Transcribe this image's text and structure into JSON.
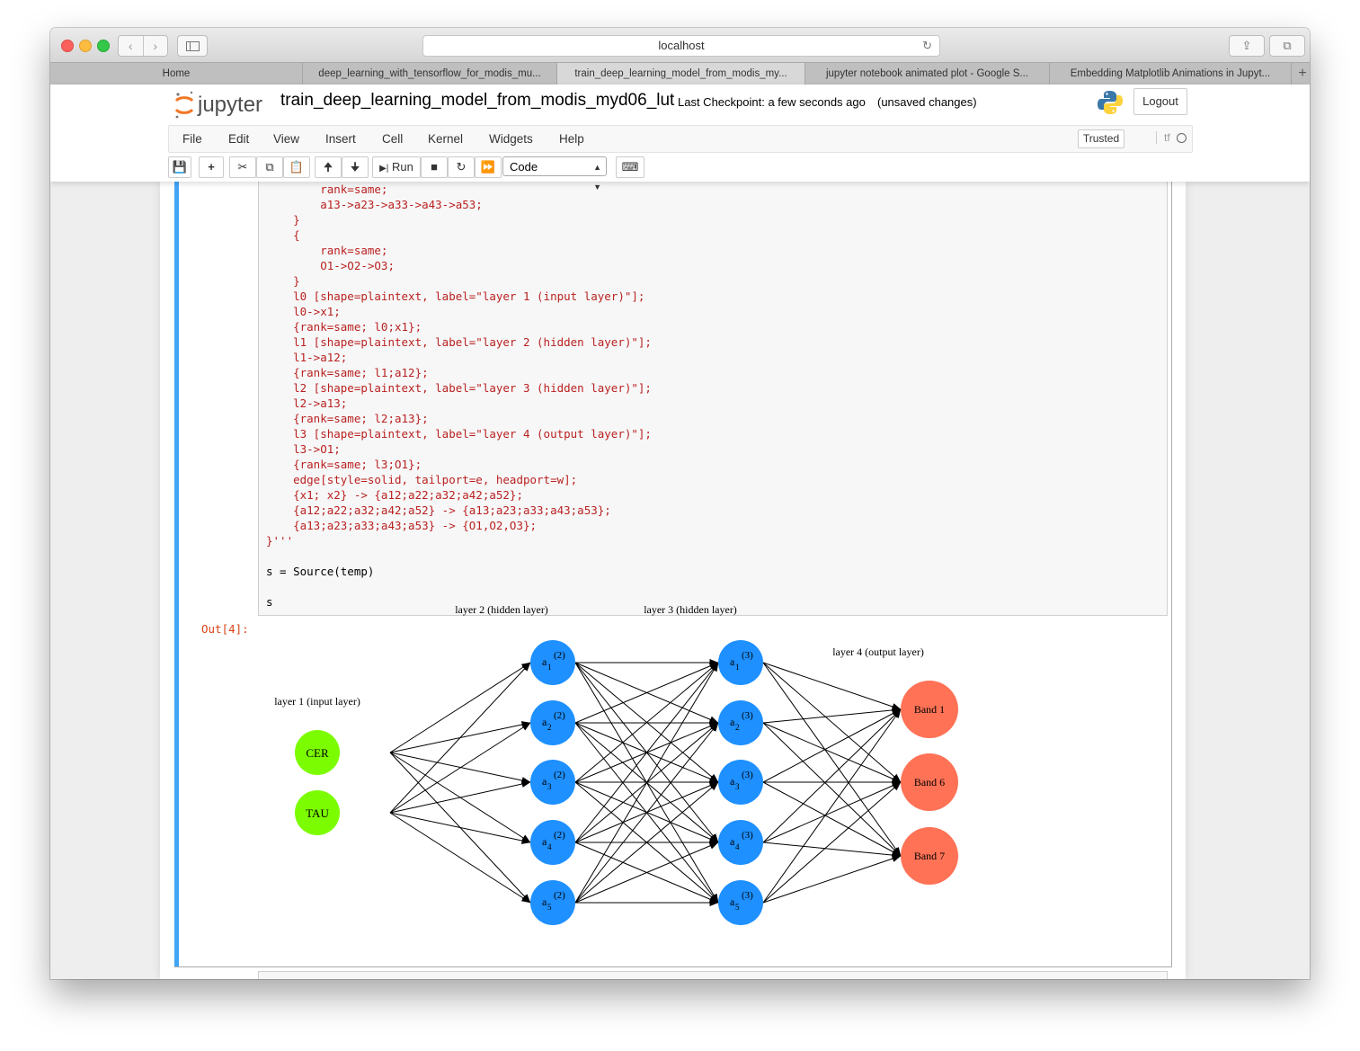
{
  "browser": {
    "url": "localhost",
    "tabs": [
      {
        "label": "Home",
        "active": false
      },
      {
        "label": "deep_learning_with_tensorflow_for_modis_mu...",
        "active": false
      },
      {
        "label": "train_deep_learning_model_from_modis_my...",
        "active": true
      },
      {
        "label": "jupyter notebook animated plot - Google S...",
        "active": false
      },
      {
        "label": "Embedding Matplotlib Animations in Jupyt...",
        "active": false
      }
    ],
    "new_tab_label": "+"
  },
  "header": {
    "logo_text": "jupyter",
    "notebook_name": "train_deep_learning_model_from_modis_myd06_lut",
    "checkpoint": "Last Checkpoint: a few seconds ago",
    "unsaved": "(unsaved changes)",
    "logout": "Logout"
  },
  "menu": {
    "items": [
      "File",
      "Edit",
      "View",
      "Insert",
      "Cell",
      "Kernel",
      "Widgets",
      "Help"
    ],
    "trusted": "Trusted",
    "kernel": "tf"
  },
  "toolbar": {
    "run_label": "Run",
    "cell_type": "Code"
  },
  "cell": {
    "code_lines": [
      "        rank=same;",
      "        a13->a23->a33->a43->a53;",
      "    }",
      "    {",
      "        rank=same;",
      "        O1->O2->O3;",
      "    }",
      "    l0 [shape=plaintext, label=\"layer 1 (input layer)\"];",
      "    l0->x1;",
      "    {rank=same; l0;x1};",
      "    l1 [shape=plaintext, label=\"layer 2 (hidden layer)\"];",
      "    l1->a12;",
      "    {rank=same; l1;a12};",
      "    l2 [shape=plaintext, label=\"layer 3 (hidden layer)\"];",
      "    l2->a13;",
      "    {rank=same; l2;a13};",
      "    l3 [shape=plaintext, label=\"layer 4 (output layer)\"];",
      "    l3->O1;",
      "    {rank=same; l3;O1};",
      "    edge[style=solid, tailport=e, headport=w];",
      "    {x1; x2} -> {a12;a22;a32;a42;a52};",
      "    {a12;a22;a32;a42;a52} -> {a13;a23;a33;a43;a53};",
      "    {a13;a23;a33;a43;a53} -> {O1,O2,O3};",
      "}'''",
      "",
      "s = Source(temp)",
      "",
      "s"
    ],
    "out_prompt": "Out[4]:"
  },
  "graph": {
    "layer_labels": [
      "layer 1 (input layer)",
      "layer 2 (hidden layer)",
      "layer 3 (hidden layer)",
      "layer 4 (output layer)"
    ],
    "input_nodes": [
      "CER",
      "TAU"
    ],
    "hidden1_nodes": [
      {
        "base": "a",
        "sub": "1",
        "sup": "(2)"
      },
      {
        "base": "a",
        "sub": "2",
        "sup": "(2)"
      },
      {
        "base": "a",
        "sub": "3",
        "sup": "(2)"
      },
      {
        "base": "a",
        "sub": "4",
        "sup": "(2)"
      },
      {
        "base": "a",
        "sub": "5",
        "sup": "(2)"
      }
    ],
    "hidden2_nodes": [
      {
        "base": "a",
        "sub": "1",
        "sup": "(3)"
      },
      {
        "base": "a",
        "sub": "2",
        "sup": "(3)"
      },
      {
        "base": "a",
        "sub": "3",
        "sup": "(3)"
      },
      {
        "base": "a",
        "sub": "4",
        "sup": "(3)"
      },
      {
        "base": "a",
        "sub": "5",
        "sup": "(3)"
      }
    ],
    "output_nodes": [
      "Band 1",
      "Band 6",
      "Band 7"
    ],
    "colors": {
      "input": "#7cfc00",
      "hidden": "#1e90ff",
      "output": "#ff7256"
    }
  }
}
